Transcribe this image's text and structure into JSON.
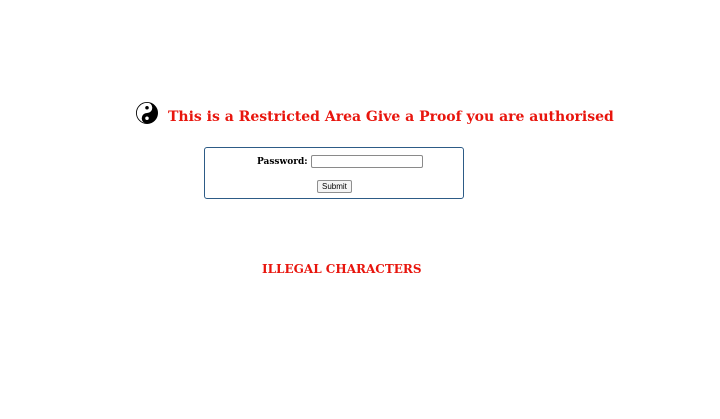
{
  "header": {
    "icon": "yin-yang-icon",
    "title": "This is a Restricted Area Give a Proof you are authorised"
  },
  "login_form": {
    "password_label": "Password:",
    "password_value": "",
    "submit_label": "Submit"
  },
  "message": {
    "error_text": "ILLEGAL CHARACTERS"
  },
  "colors": {
    "accent_red": "#e8150d",
    "box_border": "#2d5b86"
  }
}
